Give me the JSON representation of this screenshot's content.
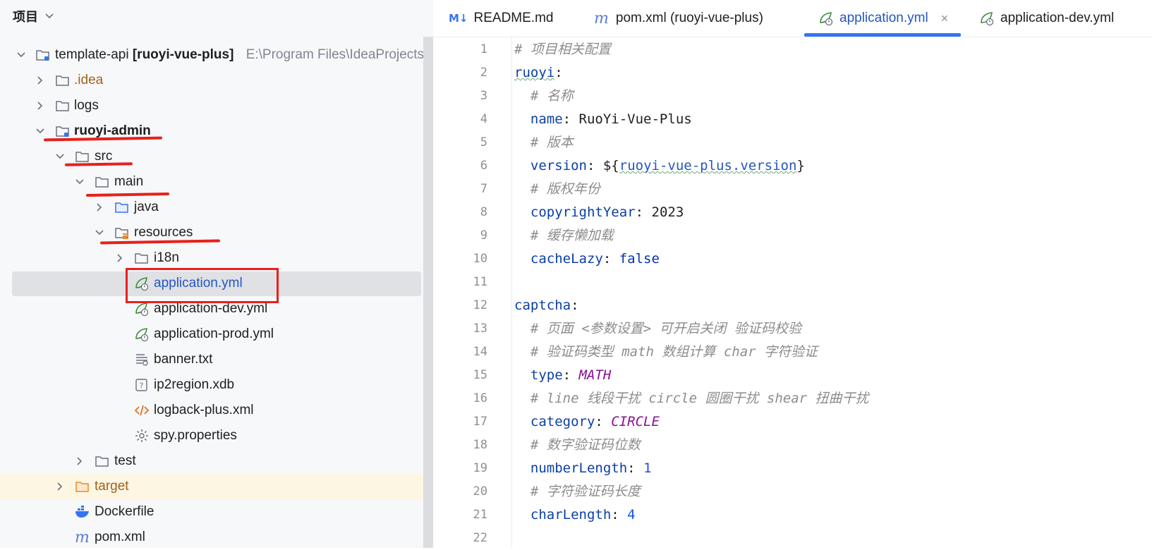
{
  "project_panel": {
    "title": "项目",
    "tree": [
      {
        "label": "template-api",
        "suffix": "[ruoyi-vue-plus]",
        "path": "E:\\Program Files\\IdeaProjects\\t",
        "icon": "module-folder-icon",
        "expanded": true
      },
      {
        "label": ".idea",
        "icon": "folder-icon",
        "expanded": false
      },
      {
        "label": "logs",
        "icon": "folder-icon",
        "expanded": false
      },
      {
        "label": "ruoyi-admin",
        "icon": "module-folder-icon",
        "expanded": true
      },
      {
        "label": "src",
        "icon": "folder-icon",
        "expanded": true
      },
      {
        "label": "main",
        "icon": "folder-icon",
        "expanded": true
      },
      {
        "label": "java",
        "icon": "source-folder-icon",
        "expanded": false
      },
      {
        "label": "resources",
        "icon": "resources-folder-icon",
        "expanded": true
      },
      {
        "label": "i18n",
        "icon": "folder-icon",
        "expanded": false
      },
      {
        "label": "application.yml",
        "icon": "spring-yaml-icon",
        "selected": true
      },
      {
        "label": "application-dev.yml",
        "icon": "spring-yaml-icon"
      },
      {
        "label": "application-prod.yml",
        "icon": "spring-yaml-icon"
      },
      {
        "label": "banner.txt",
        "icon": "text-file-icon"
      },
      {
        "label": "ip2region.xdb",
        "icon": "unknown-file-icon"
      },
      {
        "label": "logback-plus.xml",
        "icon": "xml-file-icon"
      },
      {
        "label": "spy.properties",
        "icon": "properties-gear-icon"
      },
      {
        "label": "test",
        "icon": "folder-icon",
        "expanded": false
      },
      {
        "label": "target",
        "icon": "excluded-folder-icon",
        "expanded": false
      },
      {
        "label": "Dockerfile",
        "icon": "docker-icon"
      },
      {
        "label": "pom.xml",
        "icon": "maven-icon"
      }
    ]
  },
  "editor": {
    "tabs": [
      {
        "label": "README.md",
        "icon": "markdown-icon",
        "icon_text": "M↓"
      },
      {
        "label": "pom.xml (ruoyi-vue-plus)",
        "icon": "maven-icon",
        "icon_text": "m"
      },
      {
        "label": "application.yml",
        "icon": "spring-yaml-icon",
        "active": true,
        "close": "×"
      },
      {
        "label": "application-dev.yml",
        "icon": "spring-yaml-icon"
      }
    ],
    "line_numbers": [
      "1",
      "2",
      "3",
      "4",
      "5",
      "6",
      "7",
      "8",
      "9",
      "10",
      "11",
      "12",
      "13",
      "14",
      "15",
      "16",
      "17",
      "18",
      "19",
      "20",
      "21",
      "22"
    ],
    "code": {
      "l1": "# 项目相关配置",
      "l2_key": "ruoyi",
      "l3": "# 名称",
      "l4_key": "name",
      "l4_val": "RuoYi-Vue-Plus",
      "l5": "# 版本",
      "l6_key": "version",
      "l6_pre": "${",
      "l6_ref": "ruoyi-vue-plus.version",
      "l6_post": "}",
      "l7": "# 版权年份",
      "l8_key": "copyrightYear",
      "l8_val": "2023",
      "l9": "# 缓存懒加载",
      "l10_key": "cacheLazy",
      "l10_val": "false",
      "l12_key": "captcha",
      "l13": "# 页面 <参数设置> 可开启关闭 验证码校验",
      "l14": "# 验证码类型 math 数组计算 char 字符验证",
      "l15_key": "type",
      "l15_val": "MATH",
      "l16": "# line 线段干扰 circle 圆圈干扰 shear 扭曲干扰",
      "l17_key": "category",
      "l17_val": "CIRCLE",
      "l18": "# 数字验证码位数",
      "l19_key": "numberLength",
      "l19_val": "1",
      "l20": "# 字符验证码长度",
      "l21_key": "charLength",
      "l21_val": "4"
    }
  },
  "colors": {
    "annotation_red": "#e8201b",
    "active_tab_blue": "#3574f0",
    "selection_gray": "#dfe1e5"
  }
}
